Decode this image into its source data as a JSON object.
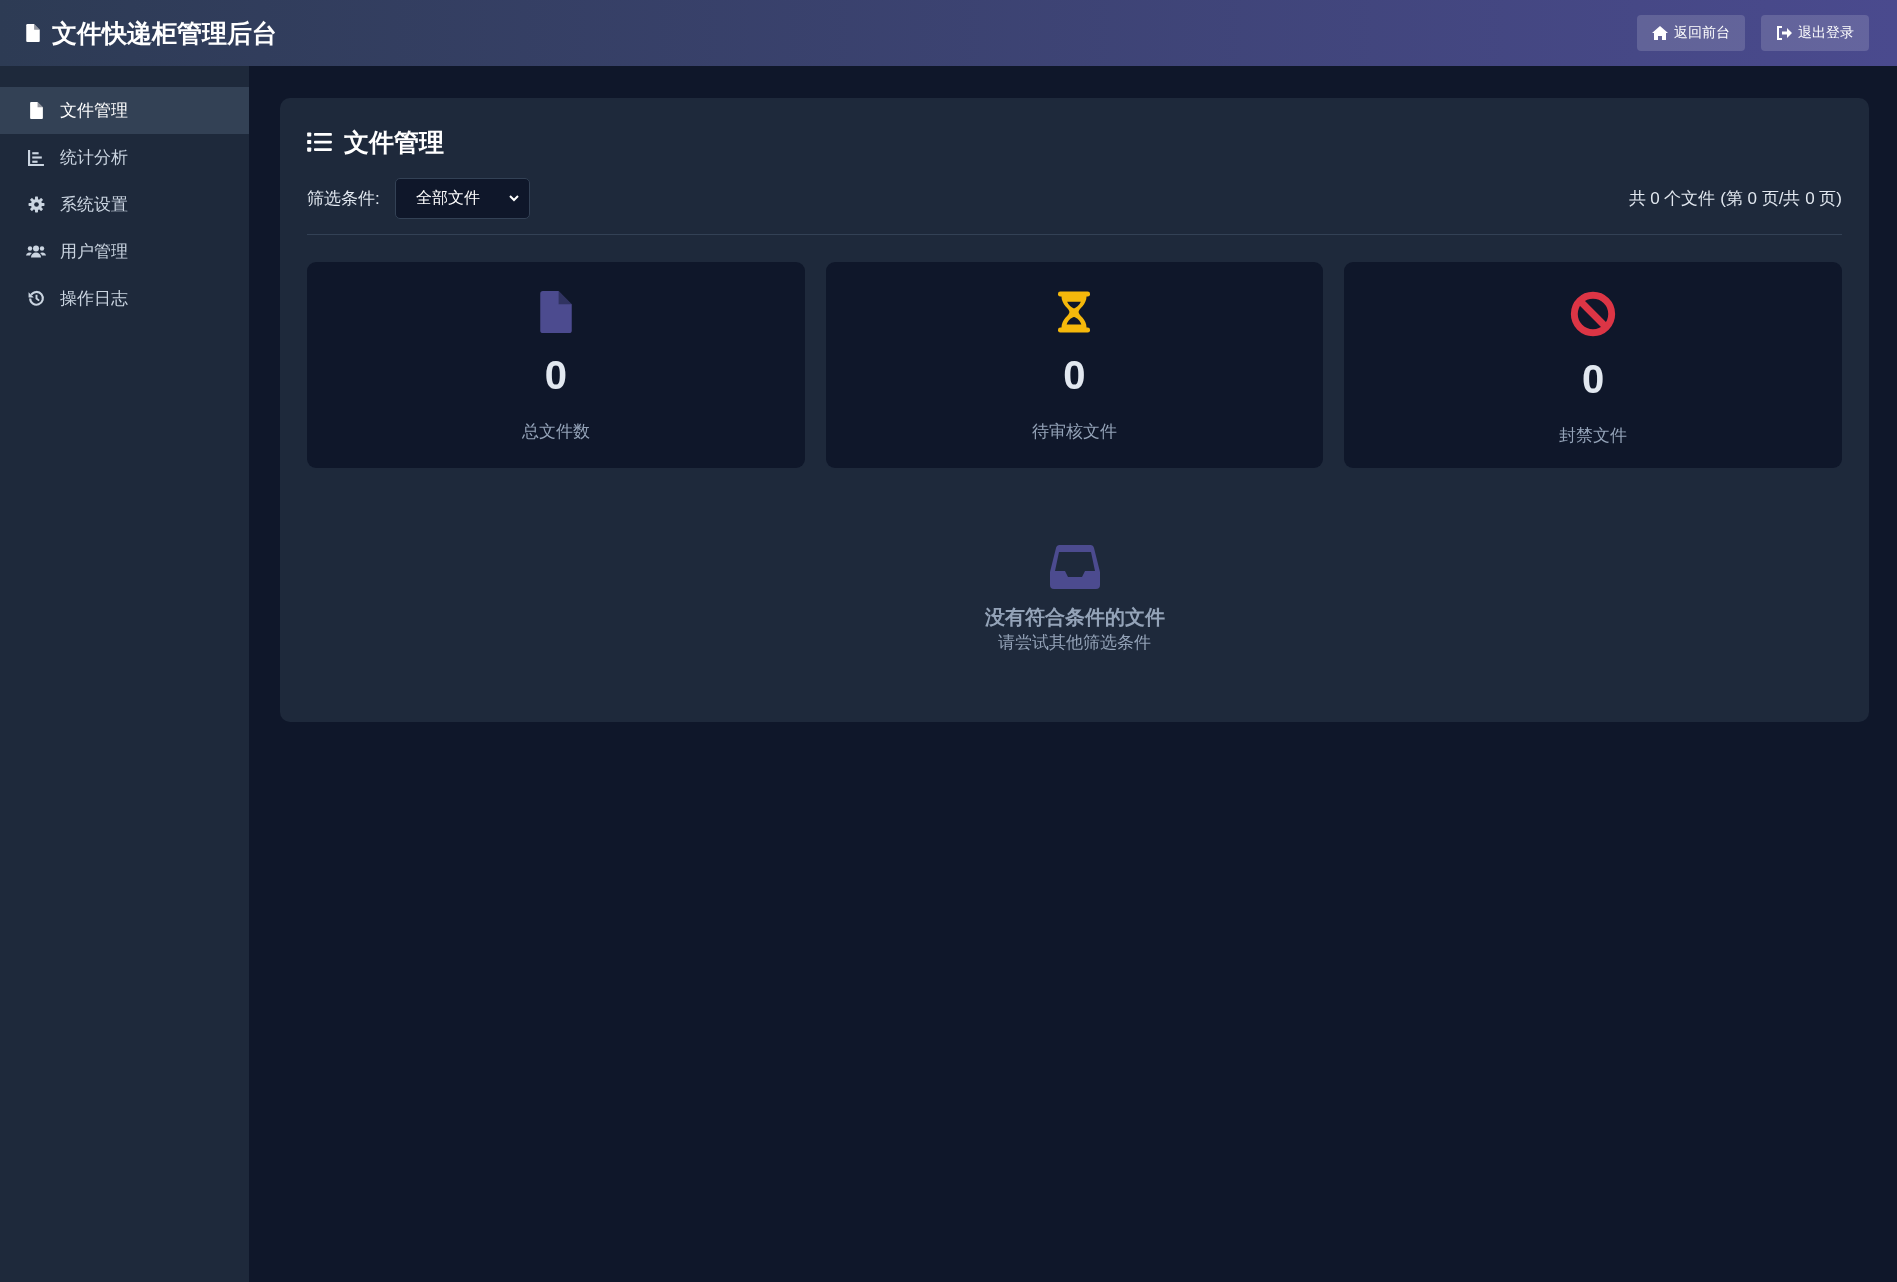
{
  "header": {
    "title": "文件快递柜管理后台",
    "buttons": [
      {
        "kind": "home",
        "label": "返回前台"
      },
      {
        "kind": "logout",
        "label": "退出登录"
      }
    ]
  },
  "sidebar": {
    "items": [
      {
        "kind": "file",
        "label": "文件管理",
        "selected": true
      },
      {
        "kind": "chart",
        "label": "统计分析",
        "selected": false
      },
      {
        "kind": "gear",
        "label": "系统设置",
        "selected": false
      },
      {
        "kind": "users",
        "label": "用户管理",
        "selected": false
      },
      {
        "kind": "history",
        "label": "操作日志",
        "selected": false
      }
    ]
  },
  "panel": {
    "title": "文件管理",
    "filter": {
      "label": "筛选条件:",
      "value": "全部文件"
    },
    "summary": "共 0 个文件 (第 0 页/共 0 页)",
    "stats": [
      {
        "kind": "file",
        "color": "#4c4b8f",
        "value": "0",
        "label": "总文件数"
      },
      {
        "kind": "hourglass",
        "color": "#f5b80b",
        "value": "0",
        "label": "待审核文件"
      },
      {
        "kind": "ban",
        "color": "#dc3545",
        "value": "0",
        "label": "封禁文件"
      }
    ],
    "empty": {
      "title": "没有符合条件的文件",
      "hint": "请尝试其他筛选条件"
    }
  }
}
